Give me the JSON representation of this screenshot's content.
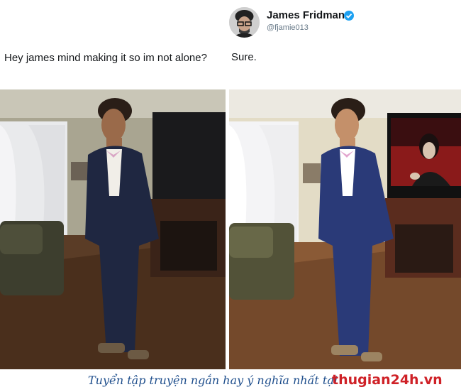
{
  "tweet": {
    "author_name": "James Fridman",
    "author_handle": "@fjamie013",
    "request_text": "Hey james mind making it so im not alone?",
    "reply_text": "Sure.",
    "verified_icon": "verified-badge-icon"
  },
  "photos": [
    {
      "label": "original-photo",
      "tv_content": "blank-screen"
    },
    {
      "label": "edited-photo",
      "tv_content": "singer-on-screen"
    }
  ],
  "watermark": {
    "caption": "Tuyển tập truyện ngắn hay ý nghĩa nhất tại",
    "site": "thugian24h.vn"
  },
  "colors": {
    "verified_blue": "#1da1f2",
    "caption_blue": "#1e4e8c",
    "site_red": "#cf2127"
  }
}
